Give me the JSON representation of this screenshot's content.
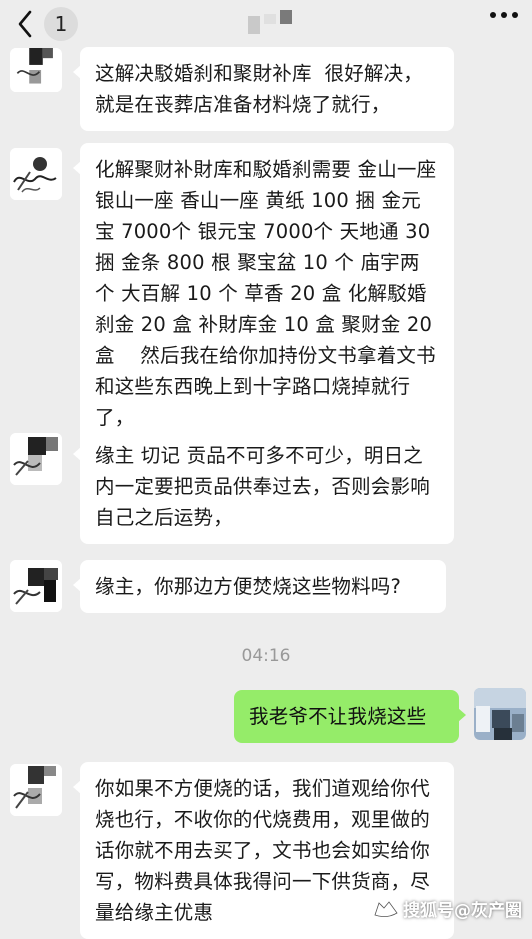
{
  "header": {
    "unread_count": "1",
    "back_icon": "chevron-left-icon",
    "more_icon": "more-dots-icon"
  },
  "messages": [
    {
      "text": "这解决駁婚刹和聚財补库  很好解决，\n就是在丧葬店准备材料烧了就行，"
    },
    {
      "text": "化解聚财补財库和駁婚刹需要 金山一座 银山一座 香山一座 黄纸 100 捆 金元宝 7000个 银元宝 7000个 天地通 30 捆 金条 800 根 聚宝盆 10 个 庙宇两个 大百解 10 个 草香 20 盒 化解駁婚刹金 20 盒 补財库金 10 盒 聚财金 20 盒    然后我在给你加持份文书拿着文书和这些东西晚上到十字路口烧掉就行了，"
    },
    {
      "text": "缘主 切记 贡品不可多不可少，明日之内一定要把贡品供奉过去，否则会影响自己之后运势，"
    },
    {
      "text": "缘主，你那边方便焚烧这些物料吗?"
    },
    {
      "text": "我老爷不让我烧这些"
    },
    {
      "text": "你如果不方便烧的话，我们道观给你代烧也行，不收你的代烧费用，观里做的话你就不用去买了，文书也会如实给你写，物料费具体我得问一下供货商，尽量给缘主优惠"
    }
  ],
  "timestamp": "04:16",
  "watermark": {
    "text": "搜狐号@灰产圈",
    "icon": "sohu-fox-icon"
  }
}
